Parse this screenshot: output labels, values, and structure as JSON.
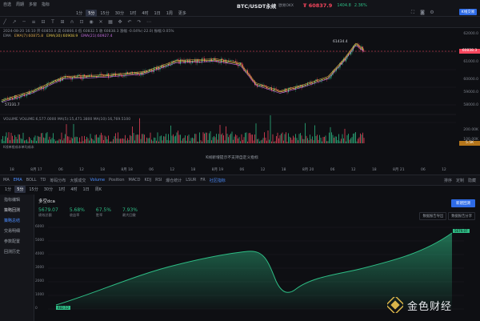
{
  "topbar": {
    "left_items": [
      "自选",
      "周期",
      "多窗",
      "指标",
      "画线"
    ],
    "timeframes": [
      "1分",
      "5分",
      "15分",
      "30分",
      "1时",
      "4时",
      "1日",
      "1周",
      "更多"
    ],
    "active_timeframe": "5分",
    "symbol": "BTC/USDT永续",
    "exchange": "欧易OKX",
    "price": "₮ 60837.9",
    "change_abs": "1404.8",
    "change_pct": "2.36%",
    "trade_button": "K线交易"
  },
  "chart_header": {
    "ohlc": "2024-08-20 16:10  开 60850.0  高 60866.0  低 60832.5  收 60838.3  涨幅 -0.04%(-22.0)  振幅 0.05%",
    "ema_label": "EMA",
    "ema1": "EMA(7):60875.8",
    "ema2": "EMA(30):60908.9",
    "ema3": "EMA(21):60927.4"
  },
  "price_axis": {
    "ticks": [
      "62000.0",
      "61000.0",
      "60000.0",
      "59000.0",
      "58000.0",
      "57000.0"
    ],
    "current_price": "60838.3",
    "high_label": "61434.4",
    "low_label": "57231.7"
  },
  "volume_panel": {
    "legend": "VOLUME  VOLUME:6,577.0000  MA(5):15,471.3800  MA(10):16,769.5100",
    "ticks": [
      "200.00K",
      "100.00K"
    ],
    "current": "5.5K",
    "note": "K线单根成本单均成本"
  },
  "notice": "K线新增提示不支持自定义指标",
  "x_axis": [
    "18",
    "8月 17",
    "06",
    "12",
    "18",
    "8月 18",
    "06",
    "12",
    "18",
    "8月 19",
    "06",
    "12",
    "18",
    "8月 20",
    "06",
    "12",
    "18",
    "8月 21",
    "06",
    "12"
  ],
  "indicators": {
    "tabs": [
      "MA",
      "EMA",
      "BOLL",
      "TD",
      "筹码分布",
      "大额成交",
      "Volume",
      "Position",
      "MACD",
      "KDJ",
      "RSI",
      "爆仓统计",
      "LSUR",
      "FR",
      "社区指标"
    ],
    "active": [
      "EMA",
      "Volume",
      "社区指标"
    ],
    "right": [
      "排序",
      "定制",
      "隐藏"
    ]
  },
  "sub_timeframes": [
    "1分",
    "5分",
    "15分",
    "30分",
    "1时",
    "4时",
    "1日",
    "周K"
  ],
  "sidebar": {
    "items": [
      "指标编辑",
      "策略回测",
      "策略总结",
      "交易明细",
      "参数配置",
      "回测历史"
    ],
    "active": "策略总结"
  },
  "strategy": {
    "name": "多空dca",
    "new_button": "新建回测",
    "metrics": [
      {
        "value": "5679.07",
        "label": "绩效总额"
      },
      {
        "value": "5.68%",
        "label": "收益率"
      },
      {
        "value": "67.5%",
        "label": "胜率"
      },
      {
        "value": "7.93%",
        "label": "最大回撤"
      }
    ],
    "buttons": [
      "数据报告导出",
      "数据报告分享"
    ],
    "y_ticks": [
      "6000",
      "5000",
      "4000",
      "3000",
      "2000",
      "1000",
      "0"
    ],
    "start_tag": "482.52",
    "end_tag": "5679.07"
  },
  "colors": {
    "up": "#2ebd85",
    "down": "#f6465d",
    "accent": "#2e6be6",
    "active_tab": "#4c8dff"
  },
  "watermark": "金色财经"
}
